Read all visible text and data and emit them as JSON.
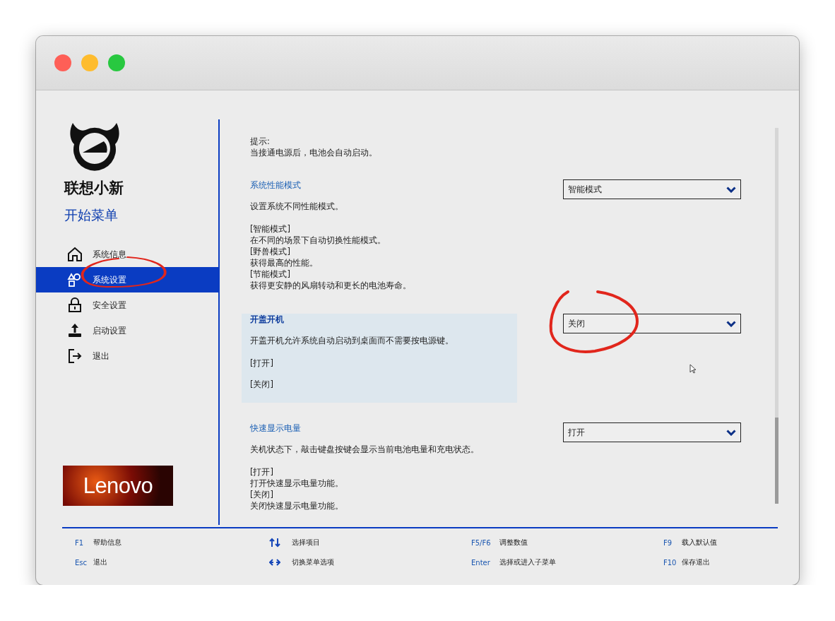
{
  "sidebar": {
    "product_name": "联想小新",
    "menu_title": "开始菜单",
    "items": [
      {
        "label": "系统信息",
        "selected": false
      },
      {
        "label": "系统设置",
        "selected": true
      },
      {
        "label": "安全设置",
        "selected": false
      },
      {
        "label": "启动设置",
        "selected": false
      },
      {
        "label": "退出",
        "selected": false
      }
    ],
    "brand": "Lenovo"
  },
  "content": {
    "notice": [
      "提示:",
      "当接通电源后，电池会自动启动。"
    ],
    "settings": [
      {
        "title": "系统性能模式",
        "description": "设置系统不同性能模式。",
        "selected": false,
        "value": "智能模式",
        "options": [
          {
            "option": "[智能模式]",
            "text": "在不同的场景下自动切换性能模式。"
          },
          {
            "option": "[野兽模式]",
            "text": "获得最高的性能。"
          },
          {
            "option": "[节能模式]",
            "text": "获得更安静的风扇转动和更长的电池寿命。"
          }
        ]
      },
      {
        "title": "开盖开机",
        "description": "开盖开机允许系统自动启动到桌面而不需要按电源键。",
        "selected": true,
        "value": "关闭",
        "options": [
          {
            "option": "[打开]"
          },
          {
            "option": "[关闭]"
          }
        ]
      },
      {
        "title": "快速显示电量",
        "description": "关机状态下，敲击键盘按键会显示当前电池电量和充电状态。",
        "selected": false,
        "value": "打开",
        "options": [
          {
            "option": "[打开]",
            "text": "打开快速显示电量功能。"
          },
          {
            "option": "[关闭]",
            "text": "关闭快速显示电量功能。"
          }
        ]
      }
    ]
  },
  "footer": {
    "hints": [
      {
        "key": "F1",
        "label": "帮助信息"
      },
      {
        "key": "Esc",
        "label": "退出"
      },
      {
        "kind": "updown",
        "label": "选择项目"
      },
      {
        "kind": "leftright",
        "label": "切换菜单选项"
      },
      {
        "key": "F5/F6",
        "label": "调整数值"
      },
      {
        "key": "Enter",
        "label": "选择或进入子菜单"
      },
      {
        "key": "F9",
        "label": "载入默认值"
      },
      {
        "key": "F10",
        "label": "保存退出"
      }
    ]
  }
}
